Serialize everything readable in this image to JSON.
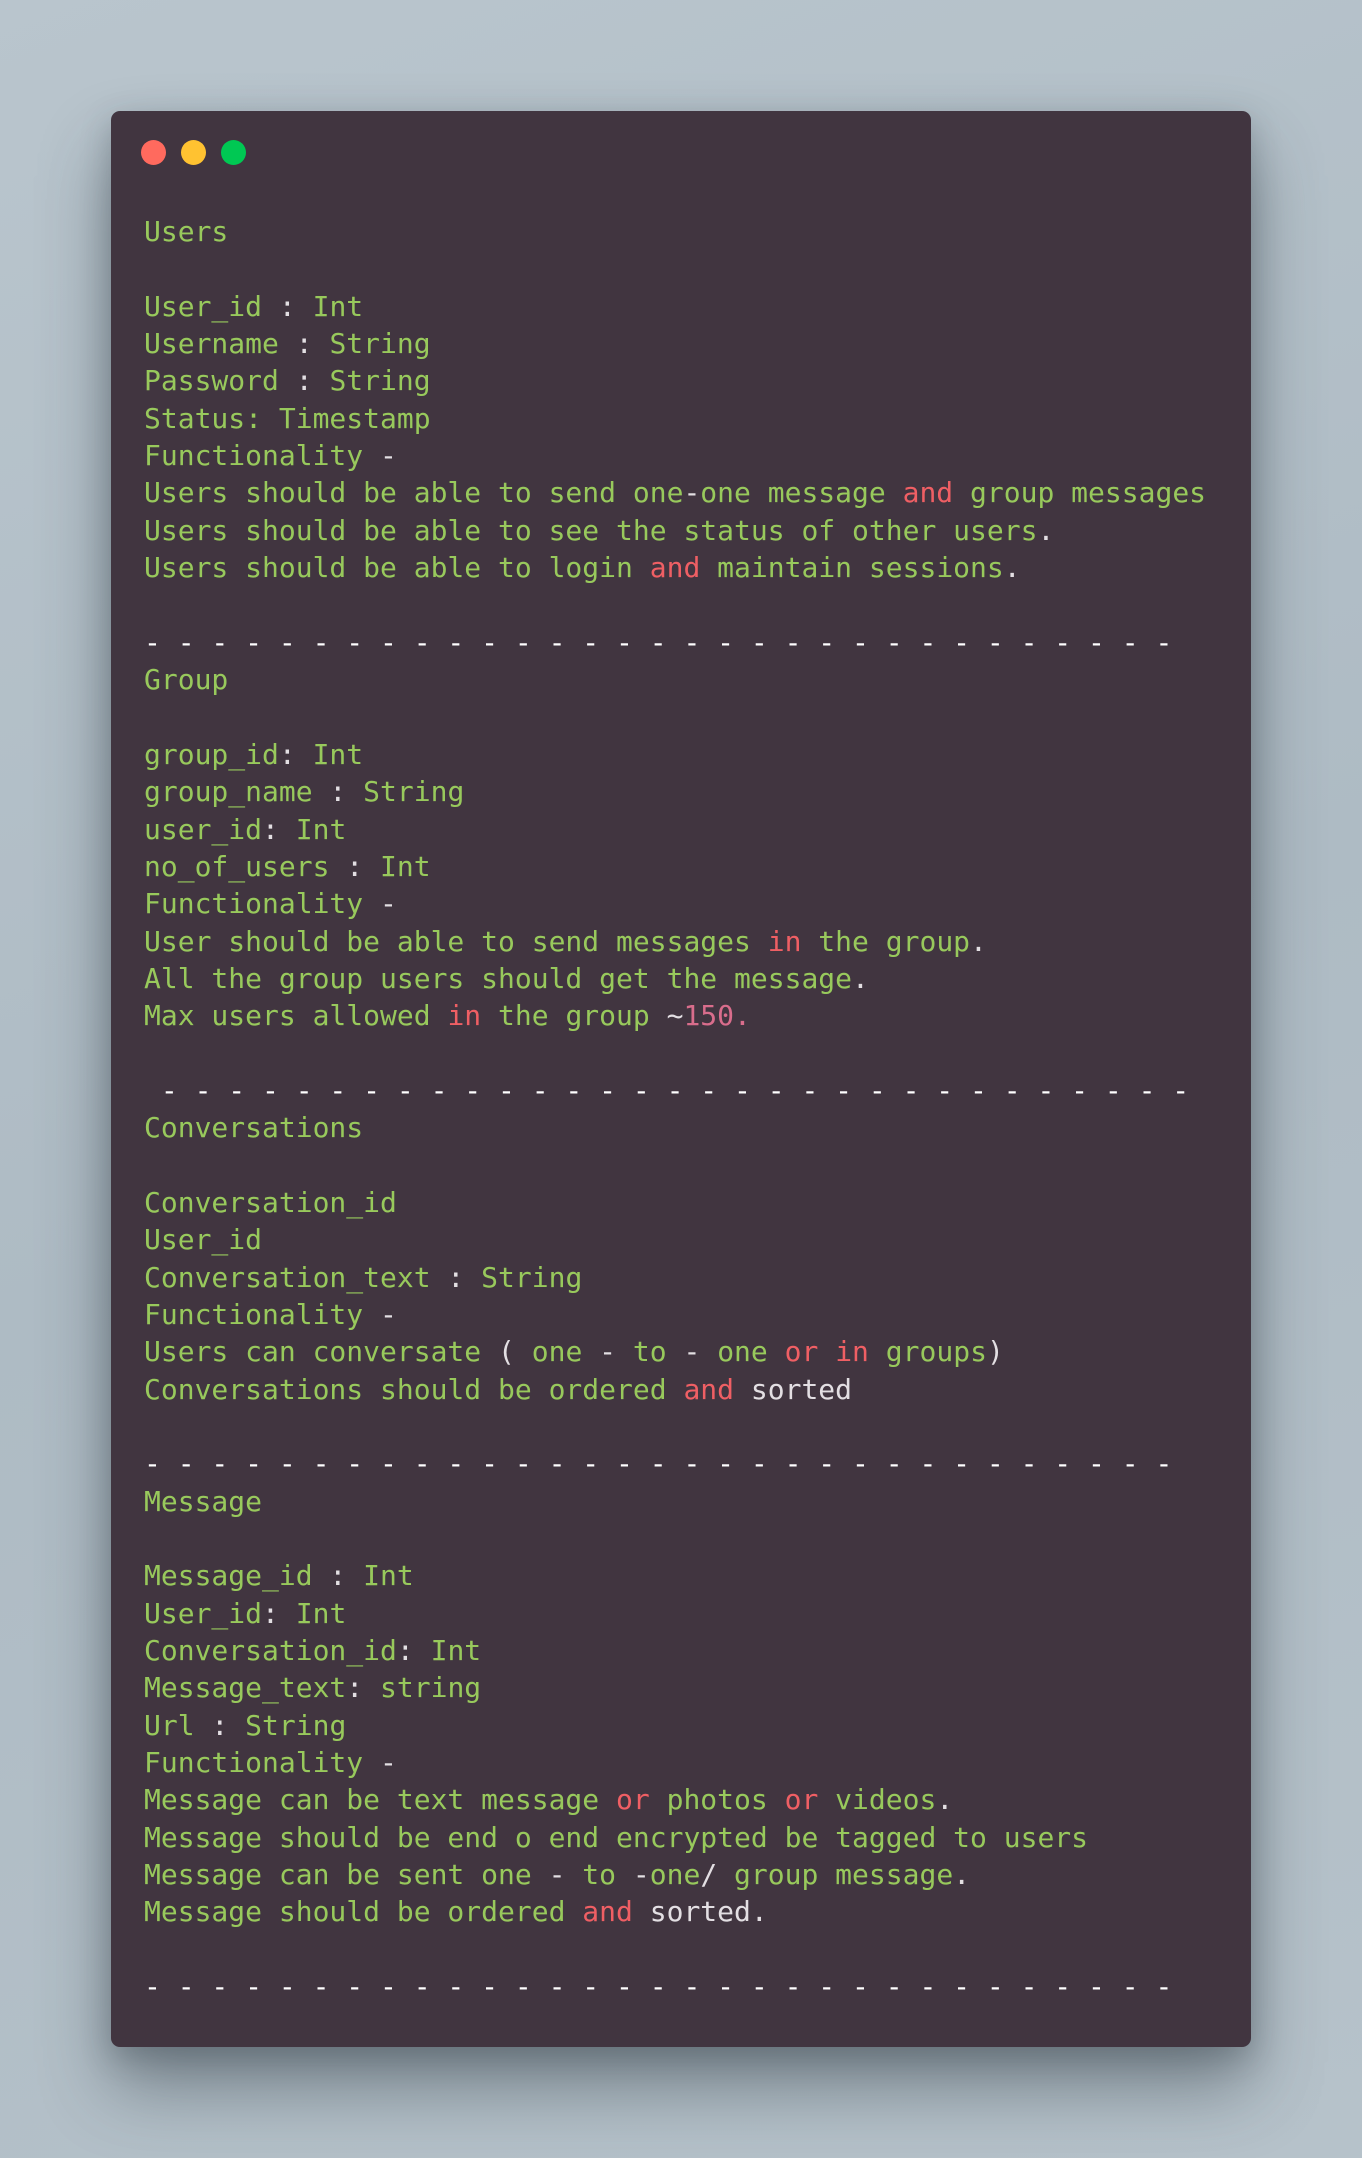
{
  "window": {
    "controls": [
      {
        "name": "close-button",
        "color": "#ff6a5e"
      },
      {
        "name": "minimize-button",
        "color": "#ffc231"
      },
      {
        "name": "maximize-button",
        "color": "#00c853"
      }
    ]
  },
  "colors": {
    "background": "#b5c1ca",
    "window": "#413540",
    "text_green": "#98c95c",
    "punctuation": "#e3dfe3",
    "keyword_red": "#ef5f64",
    "number_pink": "#d96d8c"
  },
  "separator": "- - - - - - - - - - - - - - - - - - - - - - - - - - - - - - -",
  "separator_indented": " - - - - - - - - - - - - - - - - - - - - - - - - - - - - - - -",
  "lines": [
    [
      [
        "w",
        "Users"
      ]
    ],
    [],
    [
      [
        "w",
        "User_id"
      ],
      [
        "p",
        " : "
      ],
      [
        "w",
        "Int"
      ]
    ],
    [
      [
        "w",
        "Username"
      ],
      [
        "p",
        " : "
      ],
      [
        "w",
        "String"
      ]
    ],
    [
      [
        "w",
        "Password"
      ],
      [
        "p",
        " : "
      ],
      [
        "w",
        "String"
      ]
    ],
    [
      [
        "w",
        "Status: Timestamp"
      ]
    ],
    [
      [
        "w",
        "Functionality"
      ],
      [
        "p",
        " -"
      ]
    ],
    [
      [
        "w",
        "Users should be able to send one"
      ],
      [
        "p",
        "-"
      ],
      [
        "w",
        "one message "
      ],
      [
        "k",
        "and"
      ],
      [
        "w",
        " group messages"
      ]
    ],
    [
      [
        "w",
        "Users should be able to see the status of other users"
      ],
      [
        "p",
        "."
      ]
    ],
    [
      [
        "w",
        "Users should be able to login "
      ],
      [
        "k",
        "and"
      ],
      [
        "w",
        " maintain sessions"
      ],
      [
        "p",
        "."
      ]
    ],
    [],
    [
      [
        "d",
        "- - - - - - - - - - - - - - - - - - - - - - - - - - - - - - -"
      ]
    ],
    [
      [
        "w",
        "Group"
      ]
    ],
    [],
    [
      [
        "w",
        "group_id"
      ],
      [
        "p",
        ": "
      ],
      [
        "w",
        "Int"
      ]
    ],
    [
      [
        "w",
        "group_name"
      ],
      [
        "p",
        " : "
      ],
      [
        "w",
        "String"
      ]
    ],
    [
      [
        "w",
        "user_id"
      ],
      [
        "p",
        ": "
      ],
      [
        "w",
        "Int"
      ]
    ],
    [
      [
        "w",
        "no_of_users"
      ],
      [
        "p",
        " : "
      ],
      [
        "w",
        "Int"
      ]
    ],
    [
      [
        "w",
        "Functionality"
      ],
      [
        "p",
        " -"
      ]
    ],
    [
      [
        "w",
        "User should be able to send messages "
      ],
      [
        "k",
        "in"
      ],
      [
        "w",
        " the group"
      ],
      [
        "p",
        "."
      ]
    ],
    [
      [
        "w",
        "All the group users should get the message"
      ],
      [
        "p",
        "."
      ]
    ],
    [
      [
        "w",
        "Max users allowed "
      ],
      [
        "k",
        "in"
      ],
      [
        "w",
        " the group "
      ],
      [
        "p",
        "~"
      ],
      [
        "n",
        "150."
      ]
    ],
    [],
    [
      [
        "d",
        " - - - - - - - - - - - - - - - - - - - - - - - - - - - - - - -"
      ]
    ],
    [
      [
        "w",
        "Conversations"
      ]
    ],
    [],
    [
      [
        "w",
        "Conversation_id"
      ]
    ],
    [
      [
        "w",
        "User_id"
      ]
    ],
    [
      [
        "w",
        "Conversation_text"
      ],
      [
        "p",
        " : "
      ],
      [
        "w",
        "String"
      ]
    ],
    [
      [
        "w",
        "Functionality"
      ],
      [
        "p",
        " -"
      ]
    ],
    [
      [
        "w",
        "Users can conversate "
      ],
      [
        "p",
        "( "
      ],
      [
        "w",
        "one "
      ],
      [
        "p",
        "- "
      ],
      [
        "w",
        "to "
      ],
      [
        "p",
        "- "
      ],
      [
        "w",
        "one "
      ],
      [
        "k",
        "or"
      ],
      [
        "w",
        " "
      ],
      [
        "k",
        "in"
      ],
      [
        "w",
        " groups"
      ],
      [
        "p",
        ")"
      ]
    ],
    [
      [
        "w",
        "Conversations should be ordered "
      ],
      [
        "k",
        "and"
      ],
      [
        "t",
        " sorted"
      ]
    ],
    [],
    [
      [
        "d",
        "- - - - - - - - - - - - - - - - - - - - - - - - - - - - - - -"
      ]
    ],
    [
      [
        "w",
        "Message"
      ]
    ],
    [],
    [
      [
        "w",
        "Message_id"
      ],
      [
        "p",
        " : "
      ],
      [
        "w",
        "Int"
      ]
    ],
    [
      [
        "w",
        "User_id"
      ],
      [
        "p",
        ": "
      ],
      [
        "w",
        "Int"
      ]
    ],
    [
      [
        "w",
        "Conversation_id"
      ],
      [
        "p",
        ": "
      ],
      [
        "w",
        "Int"
      ]
    ],
    [
      [
        "w",
        "Message_text"
      ],
      [
        "p",
        ": "
      ],
      [
        "w",
        "string"
      ]
    ],
    [
      [
        "w",
        "Url"
      ],
      [
        "p",
        " : "
      ],
      [
        "w",
        "String"
      ]
    ],
    [
      [
        "w",
        "Functionality"
      ],
      [
        "p",
        " -"
      ]
    ],
    [
      [
        "w",
        "Message can be text message "
      ],
      [
        "k",
        "or"
      ],
      [
        "w",
        " photos "
      ],
      [
        "k",
        "or"
      ],
      [
        "w",
        " videos"
      ],
      [
        "p",
        "."
      ]
    ],
    [
      [
        "w",
        "Message should be end o end encrypted be tagged to users"
      ]
    ],
    [
      [
        "w",
        "Message can be sent one "
      ],
      [
        "p",
        "- "
      ],
      [
        "w",
        "to "
      ],
      [
        "p",
        "-"
      ],
      [
        "w",
        "one"
      ],
      [
        "p",
        "/ "
      ],
      [
        "w",
        "group message"
      ],
      [
        "p",
        "."
      ]
    ],
    [
      [
        "w",
        "Message should be ordered "
      ],
      [
        "k",
        "and"
      ],
      [
        "t",
        " sorted."
      ]
    ],
    [],
    [
      [
        "d",
        "- - - - - - - - - - - - - - - - - - - - - - - - - - - - - - -"
      ]
    ]
  ]
}
